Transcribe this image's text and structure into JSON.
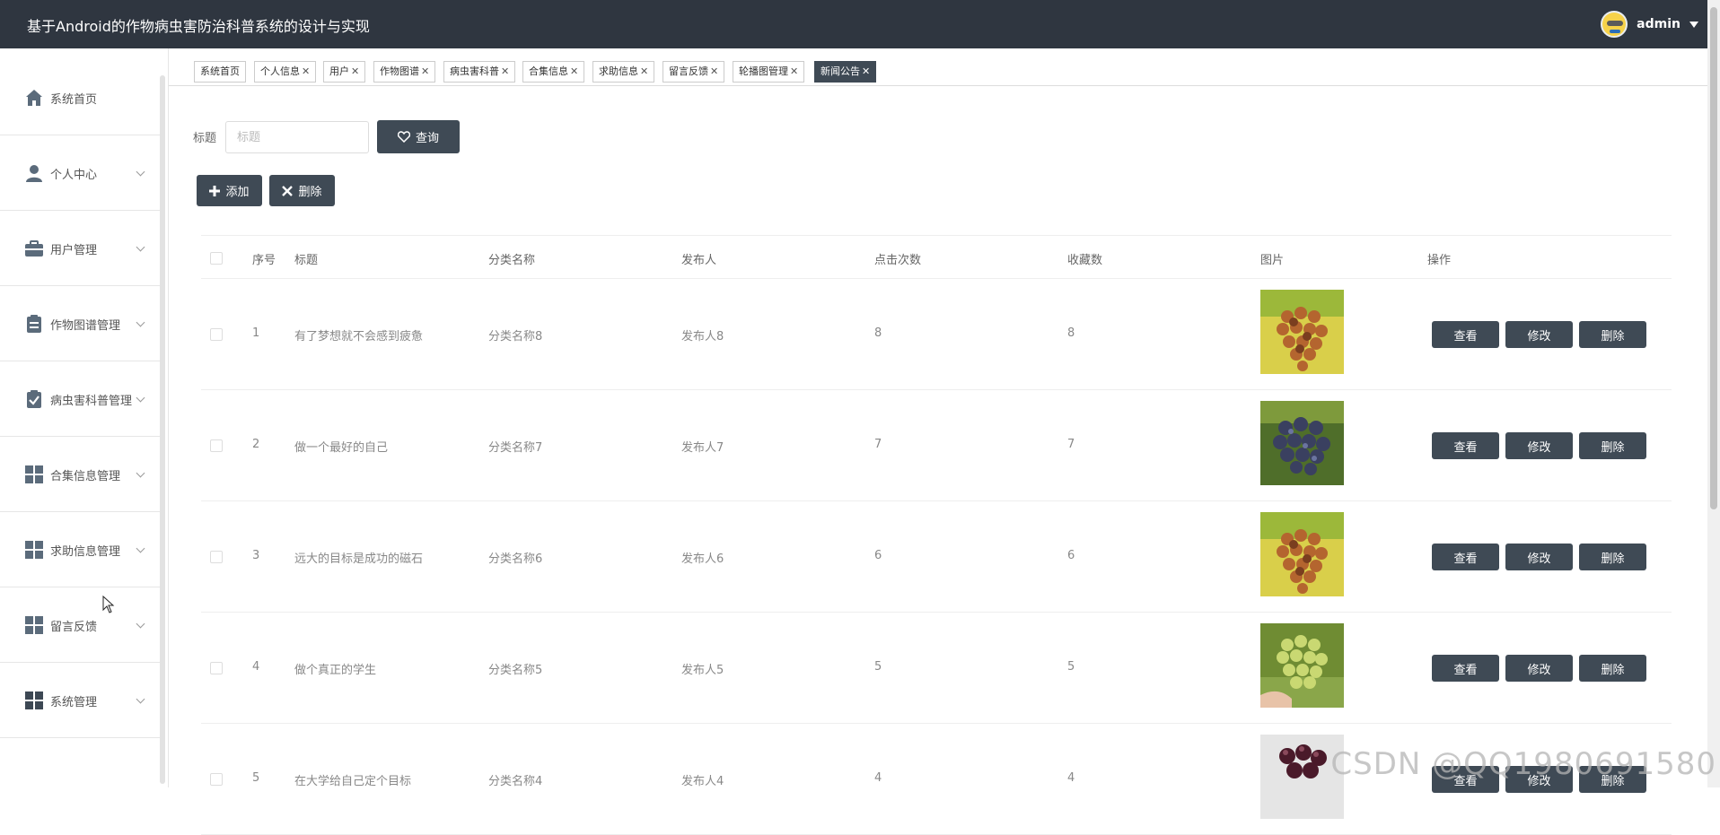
{
  "app": {
    "title": "基于Android的作物病虫害防治科普系统的设计与实现"
  },
  "user": {
    "name": "admin"
  },
  "sidebar": {
    "items": [
      {
        "label": "系统首页",
        "icon": "home-icon"
      },
      {
        "label": "个人中心",
        "icon": "person-icon"
      },
      {
        "label": "用户管理",
        "icon": "briefcase-icon"
      },
      {
        "label": "作物图谱管理",
        "icon": "clipboard-icon"
      },
      {
        "label": "病虫害科普管理",
        "icon": "checklist-icon"
      },
      {
        "label": "合集信息管理",
        "icon": "grid-icon"
      },
      {
        "label": "求助信息管理",
        "icon": "grid-icon"
      },
      {
        "label": "留言反馈",
        "icon": "grid-icon"
      },
      {
        "label": "系统管理",
        "icon": "grid-icon"
      }
    ]
  },
  "tabs": [
    {
      "label": "系统首页",
      "closable": false
    },
    {
      "label": "个人信息",
      "closable": true
    },
    {
      "label": "用户",
      "closable": true
    },
    {
      "label": "作物图谱",
      "closable": true
    },
    {
      "label": "病虫害科普",
      "closable": true
    },
    {
      "label": "合集信息",
      "closable": true
    },
    {
      "label": "求助信息",
      "closable": true
    },
    {
      "label": "留言反馈",
      "closable": true
    },
    {
      "label": "轮播图管理",
      "closable": true
    },
    {
      "label": "新闻公告",
      "closable": true,
      "active": true
    }
  ],
  "search": {
    "label": "标题",
    "placeholder": "标题",
    "query_button": "查询"
  },
  "actions": {
    "add": "添加",
    "delete": "删除"
  },
  "table": {
    "headers": {
      "index": "序号",
      "title": "标题",
      "category": "分类名称",
      "publisher": "发布人",
      "clicks": "点击次数",
      "favorites": "收藏数",
      "image": "图片",
      "ops": "操作"
    },
    "rows": [
      {
        "index": "1",
        "title": "有了梦想就不会感到疲惫",
        "category": "分类名称8",
        "publisher": "发布人8",
        "clicks": "8",
        "favorites": "8",
        "image": "grapes-red"
      },
      {
        "index": "2",
        "title": "做一个最好的自己",
        "category": "分类名称7",
        "publisher": "发布人7",
        "clicks": "7",
        "favorites": "7",
        "image": "grapes-blue"
      },
      {
        "index": "3",
        "title": "远大的目标是成功的磁石",
        "category": "分类名称6",
        "publisher": "发布人6",
        "clicks": "6",
        "favorites": "6",
        "image": "grapes-red"
      },
      {
        "index": "4",
        "title": "做个真正的学生",
        "category": "分类名称5",
        "publisher": "发布人5",
        "clicks": "5",
        "favorites": "5",
        "image": "grapes-green"
      },
      {
        "index": "5",
        "title": "在大学给自己定个目标",
        "category": "分类名称4",
        "publisher": "发布人4",
        "clicks": "4",
        "favorites": "4",
        "image": "grapes-purple"
      }
    ],
    "row_ops": {
      "view": "查看",
      "edit": "修改",
      "delete": "删除"
    }
  },
  "watermark": "CSDN @QQ1980691580"
}
